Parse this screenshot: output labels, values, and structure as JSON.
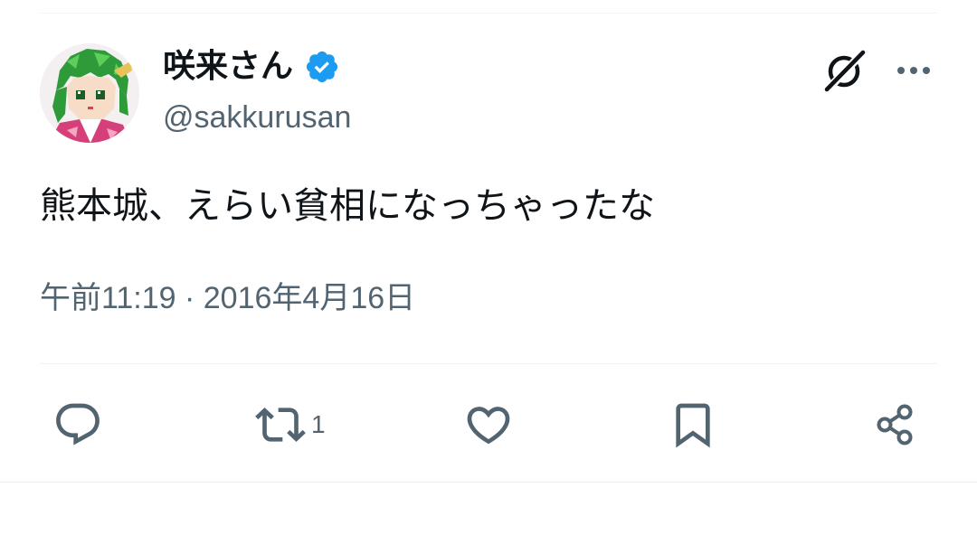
{
  "tweet": {
    "author": {
      "display_name": "咲来さん",
      "handle": "@sakkurusan",
      "verified": true,
      "avatar": "pixel-art-green-haired-girl-avatar"
    },
    "text": "熊本城、えらい貧相になっちゃったな",
    "timestamp": "午前11:19 · 2016年4月16日",
    "header_icons": [
      "grok-icon",
      "more-icon"
    ]
  },
  "actions": {
    "reply": {
      "icon": "reply-icon"
    },
    "retweet": {
      "icon": "retweet-icon",
      "count": "1"
    },
    "like": {
      "icon": "heart-icon"
    },
    "bookmark": {
      "icon": "bookmark-icon"
    },
    "share": {
      "icon": "share-icon"
    }
  },
  "colors": {
    "text_primary": "#0f1419",
    "text_secondary": "#536471",
    "verified_blue": "#1d9bf0",
    "divider": "#eff3f4"
  }
}
